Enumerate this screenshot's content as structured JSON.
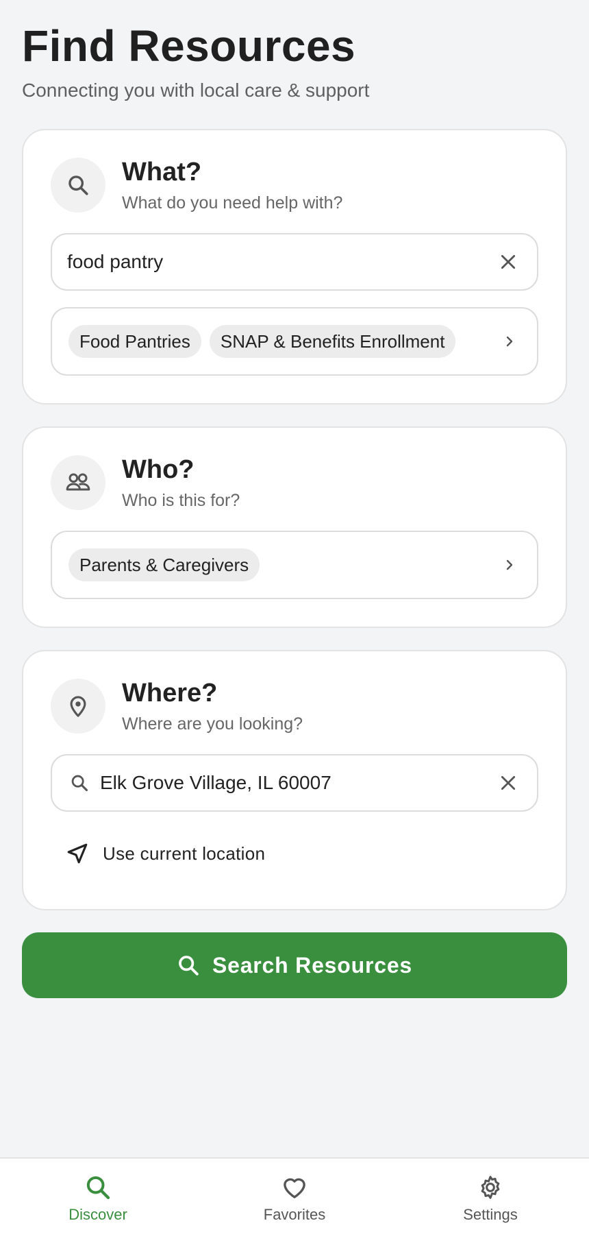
{
  "header": {
    "title": "Find Resources",
    "subtitle": "Connecting you with local care & support"
  },
  "what": {
    "title": "What?",
    "subtitle": "What do you need help with?",
    "icon": "search-icon",
    "input_value": "food pantry",
    "chips": [
      "Food Pantries",
      "SNAP & Benefits Enrollment"
    ]
  },
  "who": {
    "title": "Who?",
    "subtitle": "Who is this for?",
    "icon": "people-icon",
    "chips": [
      "Parents & Caregivers"
    ]
  },
  "where": {
    "title": "Where?",
    "subtitle": "Where are you looking?",
    "icon": "map-pin-icon",
    "input_value": "Elk Grove Village, IL 60007",
    "current_location_label": "Use current location"
  },
  "search_button": {
    "label": "Search Resources",
    "color": "#3a8f3f"
  },
  "nav": {
    "items": [
      {
        "label": "Discover",
        "icon": "search-icon",
        "active": true
      },
      {
        "label": "Favorites",
        "icon": "heart-icon",
        "active": false
      },
      {
        "label": "Settings",
        "icon": "gear-icon",
        "active": false
      }
    ],
    "active_color": "#3a8f3f"
  }
}
